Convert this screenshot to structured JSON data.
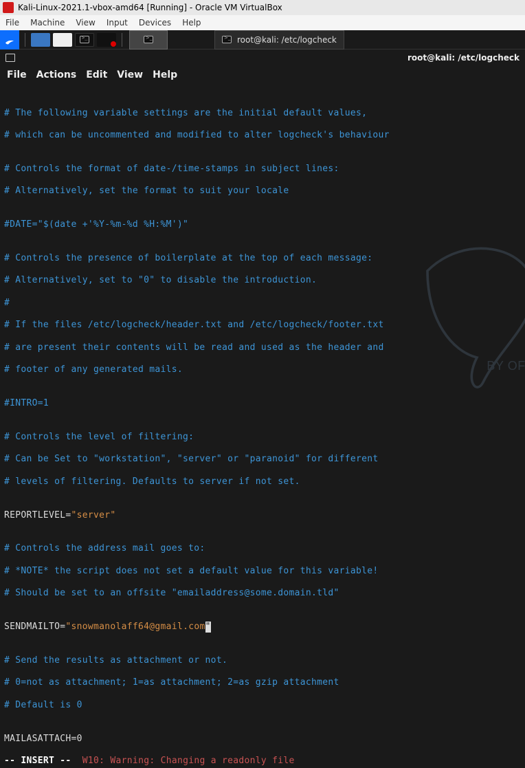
{
  "vm_titlebar": {
    "title": "Kali-Linux-2021.1-vbox-amd64 [Running] - Oracle VM VirtualBox"
  },
  "vbox_menu": {
    "file": "File",
    "machine": "Machine",
    "view": "View",
    "input": "Input",
    "devices": "Devices",
    "help": "Help"
  },
  "taskbar": {
    "app_active_label": "",
    "app2_label": "root@kali: /etc/logcheck"
  },
  "term_header": {
    "right": "root@kali: /etc/logcheck"
  },
  "term_menu": {
    "file": "File",
    "actions": "Actions",
    "edit": "Edit",
    "view": "View",
    "help": "Help"
  },
  "term": {
    "l1": "# The following variable settings are the initial default values,",
    "l2": "# which can be uncommented and modified to alter logcheck's behaviour",
    "l3": "",
    "l4": "# Controls the format of date-/time-stamps in subject lines:",
    "l5": "# Alternatively, set the format to suit your locale",
    "l6": "",
    "l7": "#DATE=\"$(date +'%Y-%m-%d %H:%M')\"",
    "l8": "",
    "l9": "# Controls the presence of boilerplate at the top of each message:",
    "l10": "# Alternatively, set to \"0\" to disable the introduction.",
    "l11": "#",
    "l12": "# If the files /etc/logcheck/header.txt and /etc/logcheck/footer.txt",
    "l13": "# are present their contents will be read and used as the header and",
    "l14": "# footer of any generated mails.",
    "l15": "",
    "l16": "#INTRO=1",
    "l17": "",
    "l18": "# Controls the level of filtering:",
    "l19": "# Can be Set to \"workstation\", \"server\" or \"paranoid\" for different",
    "l20": "# levels of filtering. Defaults to server if not set.",
    "l21": "",
    "l22a": "REPORTLEVEL=",
    "l22b": "\"server\"",
    "l23": "",
    "l24": "# Controls the address mail goes to:",
    "l25": "# *NOTE* the script does not set a default value for this variable!",
    "l26": "# Should be set to an offsite \"emailaddress@some.domain.tld\"",
    "l27": "",
    "l28a": "SENDMAILTO=",
    "l28b": "\"snowmanolaff64@gmail.com",
    "l28c": "\"",
    "l29": "",
    "l30": "# Send the results as attachment or not.",
    "l31": "# 0=not as attachment; 1=as attachment; 2=as gzip attachment",
    "l32": "# Default is 0",
    "l33": "",
    "l34": "MAILASATTACH=0",
    "mode": "-- INSERT --",
    "warn": "W10: Warning: Changing a readonly file"
  }
}
